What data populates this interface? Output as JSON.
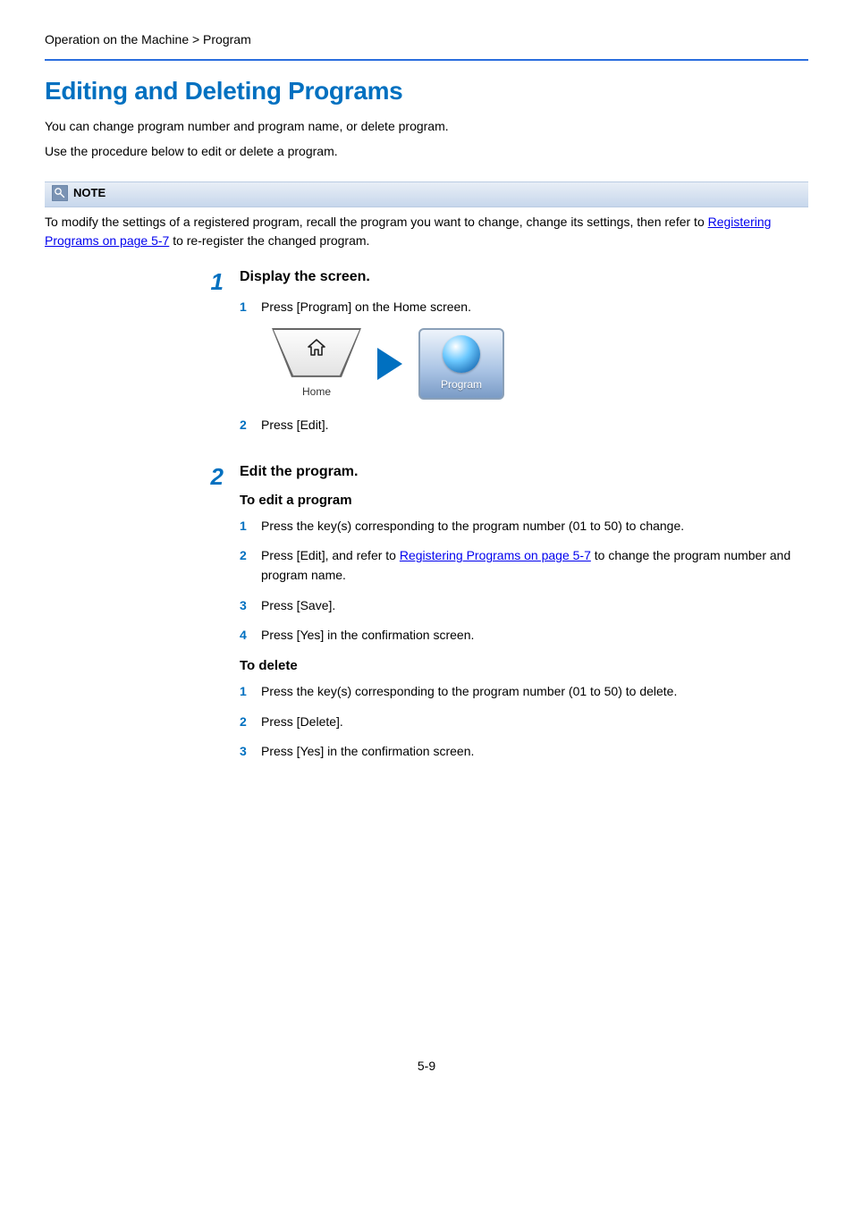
{
  "breadcrumb": "Operation on the Machine > Program",
  "title": "Editing and Deleting Programs",
  "intro1": "You can change program number and program name, or delete program.",
  "intro2": "Use the procedure below to edit or delete a program.",
  "note": {
    "label": "NOTE",
    "body_pre": "To modify the settings of a registered program, recall the program you want to change, change its settings, then refer to ",
    "link": "Registering Programs on page 5-7",
    "body_post": " to re-register the changed program."
  },
  "step1": {
    "num": "1",
    "title": "Display the screen.",
    "s1": {
      "num": "1",
      "text": "Press [Program] on the Home screen."
    },
    "home_label": "Home",
    "prog_label": "Program",
    "s2": {
      "num": "2",
      "text": "Press [Edit]."
    }
  },
  "step2": {
    "num": "2",
    "title": "Edit the program.",
    "edit_heading": "To edit a program",
    "e1": {
      "num": "1",
      "text": "Press the key(s) corresponding to the program number (01 to 50) to change."
    },
    "e2": {
      "num": "2",
      "pre": "Press [Edit], and refer to ",
      "link": "Registering Programs on page 5-7",
      "post": " to change the program number and program name."
    },
    "e3": {
      "num": "3",
      "text": "Press [Save]."
    },
    "e4": {
      "num": "4",
      "text": "Press [Yes] in the confirmation screen."
    },
    "del_heading": "To delete",
    "d1": {
      "num": "1",
      "text": "Press the key(s) corresponding to the program number (01 to 50) to delete."
    },
    "d2": {
      "num": "2",
      "text": "Press [Delete]."
    },
    "d3": {
      "num": "3",
      "text": "Press [Yes] in the confirmation screen."
    }
  },
  "page_num": "5-9"
}
